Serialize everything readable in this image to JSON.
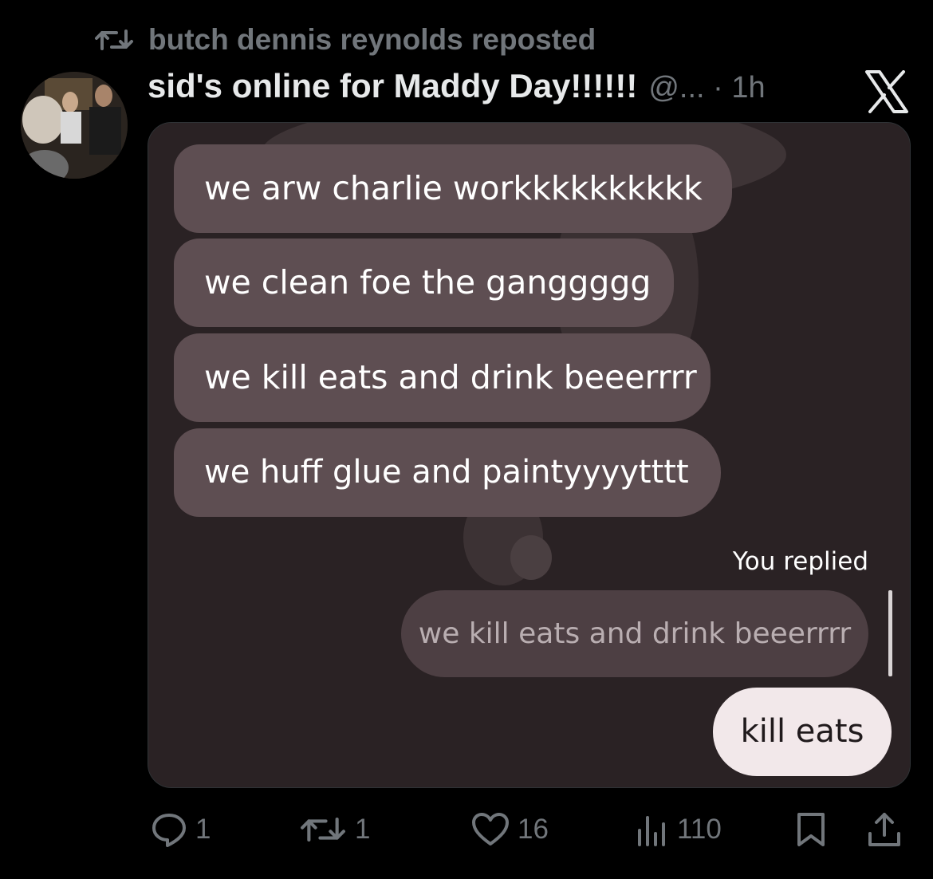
{
  "repost": {
    "icon": "repost-icon",
    "label": "butch dennis reynolds reposted"
  },
  "post": {
    "display_name": "sid's online for Maddy Day!!!!!!",
    "handle_time": "@... · 1h",
    "logo": "x-logo-icon"
  },
  "screenshot": {
    "messages": [
      "we arw charlie workkkkkkkkkk",
      "we clean foe the ganggggg",
      "we kill eats and drink beeerrrr",
      "we huff glue and paintyyyytttt"
    ],
    "replied_label": "You replied",
    "quoted_message": "we kill eats and drink beeerrrr",
    "reply": "kill eats"
  },
  "actions": {
    "replies": "1",
    "reposts": "1",
    "likes": "16",
    "views": "110"
  },
  "colors": {
    "background": "#000000",
    "muted": "#71767b",
    "bubble": "#5e4e52",
    "reply_bubble": "#f2e8ea"
  }
}
